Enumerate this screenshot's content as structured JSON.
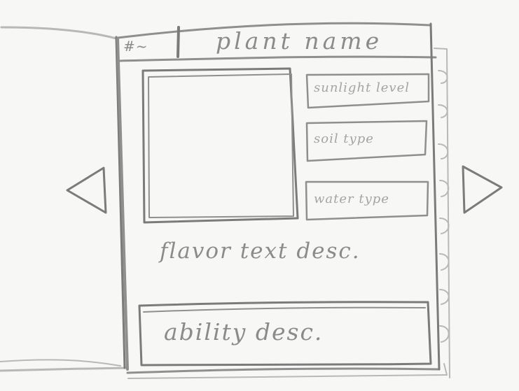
{
  "header": {
    "page_number": "#~",
    "plant_name": "plant name"
  },
  "attributes": {
    "sunlight": "sunlight level",
    "soil": "soil type",
    "water": "water type"
  },
  "content": {
    "flavor_text": "flavor text desc.",
    "ability_text": "ability desc."
  },
  "colors": {
    "paper": "#f7f7f5",
    "ink": "#8f8f8f"
  },
  "icons": {
    "previous": "left-arrow-icon",
    "next": "right-arrow-icon"
  }
}
